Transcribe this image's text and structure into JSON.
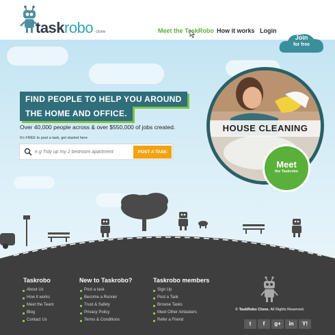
{
  "header": {
    "logo_main": "task",
    "logo_robo": "robo",
    "logo_clone": "clone",
    "nav": [
      {
        "label": "Meet the TaskRobo",
        "active": true
      },
      {
        "label": "How it works",
        "active": false
      },
      {
        "label": "Login",
        "active": false
      }
    ],
    "join_line1": "Join",
    "join_line2": "for free"
  },
  "hero": {
    "banner1": "FIND PEOPLE TO HELP YOU AROUND",
    "banner2": "THE HOME AND OFFICE.",
    "tagline": "Over 40,000 people across & over $550,000 of jobs created.",
    "free_note": "It's FREE to post a task, get started here",
    "search_placeholder": "e.g Tidy up my 2 bedroom apartment",
    "post_button": "POST A TASK",
    "photo_label": "HOUSE CLEANING",
    "meet_big": "Meet",
    "meet_small": "the Taskrobo"
  },
  "footer": {
    "columns": [
      {
        "title": "Taskrobo",
        "links": [
          "About Us",
          "How it works",
          "Meet the Team",
          "Blog",
          "Contact Us"
        ]
      },
      {
        "title": "New to Taskrobo?",
        "links": [
          "Post a task",
          "Become a Runner",
          "Trust & Safety",
          "Privacy Policy",
          "Terms & Conditions"
        ]
      },
      {
        "title": "Taskrobo members",
        "links": [
          "Sign Up",
          "Post a Task",
          "Browse Tasks",
          "Meet Other Airtaskers",
          "Refer a Friend"
        ]
      }
    ],
    "copyright_brand": "TaskRobo Clone.",
    "copyright_rest": " All Rights Reserved.",
    "copyright_symbol": "©",
    "social": [
      {
        "icon": "twitter-icon",
        "glyph": "t"
      },
      {
        "icon": "facebook-icon",
        "glyph": "f"
      },
      {
        "icon": "google-plus-icon",
        "glyph": "g+"
      },
      {
        "icon": "linkedin-icon",
        "glyph": "in"
      },
      {
        "icon": "yahoo-icon",
        "glyph": "Y!"
      }
    ]
  },
  "colors": {
    "accent_green": "#5aae3a",
    "teal": "#2f6e7a",
    "orange": "#f2a313",
    "footer_bg": "#3e3e3e"
  }
}
